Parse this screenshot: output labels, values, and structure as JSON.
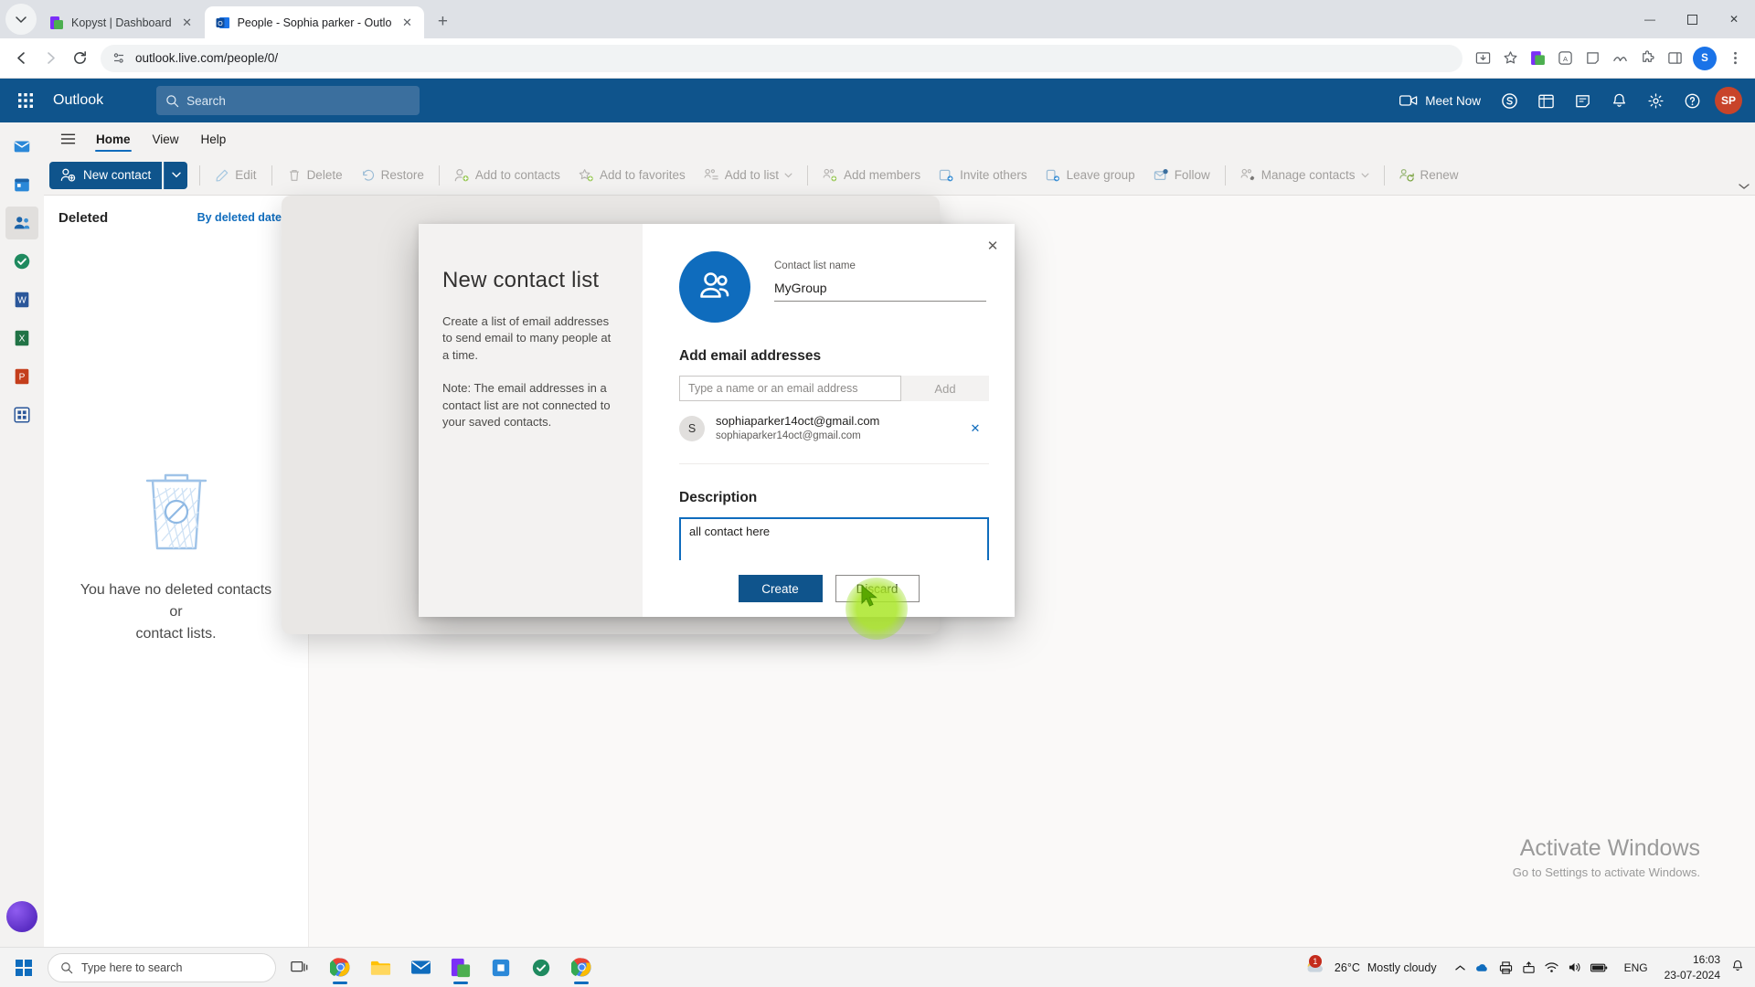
{
  "browser": {
    "tabs": [
      {
        "title": "Kopyst | Dashboard",
        "favicon": "kopyst-icon",
        "active": false
      },
      {
        "title": "People - Sophia parker - Outlo",
        "favicon": "outlook-icon",
        "active": true
      }
    ],
    "new_tab_label": "+",
    "tab_close_label": "✕",
    "url": "outlook.live.com/people/0/",
    "nav": {
      "back": "←",
      "forward": "→",
      "reload": "↻"
    },
    "profile_initial": "S",
    "window_controls": {
      "minimize": "—",
      "maximize": "☐",
      "close": "✕"
    }
  },
  "outlook": {
    "brand": "Outlook",
    "search_placeholder": "Search",
    "meet_now": "Meet Now",
    "avatar_initials": "SP",
    "ribbon_tabs": [
      {
        "label": "Home",
        "active": true
      },
      {
        "label": "View",
        "active": false
      },
      {
        "label": "Help",
        "active": false
      }
    ],
    "toolbar": {
      "new_contact": "New contact",
      "items": [
        {
          "label": "Edit",
          "icon": "pencil-icon",
          "sep_before": true
        },
        {
          "label": "Delete",
          "icon": "trash-icon",
          "sep_before": true
        },
        {
          "label": "Restore",
          "icon": "undo-icon",
          "sep_before": false
        },
        {
          "label": "Add to contacts",
          "icon": "add-person-icon",
          "sep_before": true
        },
        {
          "label": "Add to favorites",
          "icon": "add-star-icon",
          "sep_before": false
        },
        {
          "label": "Add to list",
          "icon": "list-icon",
          "caret": true,
          "sep_before": false
        },
        {
          "label": "Add members",
          "icon": "add-members-icon",
          "sep_before": true
        },
        {
          "label": "Invite others",
          "icon": "invite-icon",
          "sep_before": false
        },
        {
          "label": "Leave group",
          "icon": "leave-icon",
          "sep_before": false
        },
        {
          "label": "Follow",
          "icon": "mail-follow-icon",
          "sep_before": false
        },
        {
          "label": "Manage contacts",
          "icon": "manage-contacts-icon",
          "caret": true,
          "sep_before": true
        },
        {
          "label": "Renew",
          "icon": "renew-icon",
          "sep_before": true
        }
      ]
    },
    "list_pane": {
      "title": "Deleted",
      "sort_label": "By deleted date",
      "empty_line1": "You have no deleted contacts or",
      "empty_line2": "contact lists."
    }
  },
  "modal": {
    "title": "New contact list",
    "desc_p1": "Create a list of email addresses to send email to many people at a time.",
    "desc_p2": "Note: The email addresses in a contact list are not connected to your saved contacts.",
    "close_label": "✕",
    "name_label": "Contact list name",
    "name_value": "MyGroup",
    "avatar_icon": "people-group-icon",
    "add_email_title": "Add email addresses",
    "email_placeholder": "Type a name or an email address",
    "email_value": "",
    "add_button": "Add",
    "recipients": [
      {
        "initial": "S",
        "name": "sophiaparker14oct@gmail.com",
        "email": "sophiaparker14oct@gmail.com",
        "remove_label": "✕"
      }
    ],
    "description_label": "Description",
    "description_value": "all contact here",
    "create_button": "Create",
    "discard_button": "Discard"
  },
  "watermark": {
    "line1": "Activate Windows",
    "line2": "Go to Settings to activate Windows."
  },
  "taskbar": {
    "search_placeholder": "Type here to search",
    "apps": [
      {
        "name": "task-view-icon",
        "running": false
      },
      {
        "name": "chrome-icon",
        "running": true
      },
      {
        "name": "file-explorer-icon",
        "running": false
      },
      {
        "name": "mail-icon",
        "running": false
      },
      {
        "name": "kopyst-icon",
        "running": true
      },
      {
        "name": "store-icon",
        "running": false
      },
      {
        "name": "antivirus-icon",
        "running": false
      },
      {
        "name": "chrome2-icon",
        "running": true
      }
    ],
    "weather_temp": "26°C",
    "weather_desc": "Mostly cloudy",
    "weather_badge": "1",
    "language": "ENG",
    "time": "16:03",
    "date": "23-07-2024"
  },
  "colors": {
    "outlook_blue": "#0f548c",
    "accent_blue": "#0f6cbd",
    "chrome_tabstrip": "#dee1e6",
    "ribbon_bg": "#f3f2f1"
  }
}
